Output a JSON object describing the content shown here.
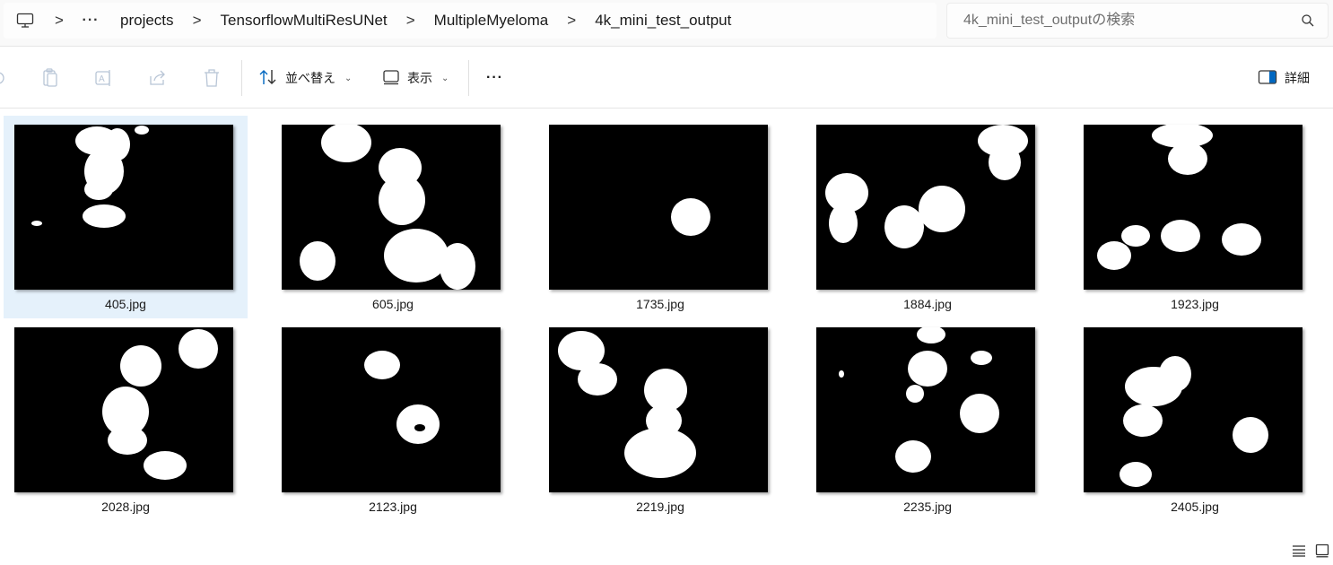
{
  "breadcrumb": {
    "more": "···",
    "items": [
      "projects",
      "TensorflowMultiResUNet",
      "MultipleMyeloma",
      "4k_mini_test_output"
    ],
    "separator": ">"
  },
  "search": {
    "placeholder": "4k_mini_test_outputの検索"
  },
  "toolbar": {
    "sort_label": "並べ替え",
    "view_label": "表示",
    "more_label": "···",
    "details_label": "詳細"
  },
  "files": [
    {
      "name": "405.jpg",
      "selected": true
    },
    {
      "name": "605.jpg",
      "selected": false
    },
    {
      "name": "1735.jpg",
      "selected": false
    },
    {
      "name": "1884.jpg",
      "selected": false
    },
    {
      "name": "1923.jpg",
      "selected": false
    },
    {
      "name": "2028.jpg",
      "selected": false
    },
    {
      "name": "2123.jpg",
      "selected": false
    },
    {
      "name": "2219.jpg",
      "selected": false
    },
    {
      "name": "2235.jpg",
      "selected": false
    },
    {
      "name": "2405.jpg",
      "selected": false
    }
  ],
  "colors": {
    "selection": "#e5f1fb",
    "accent": "#0067c0",
    "toolbar_bg": "#ffffff",
    "address_bg": "#f9f9f9"
  }
}
